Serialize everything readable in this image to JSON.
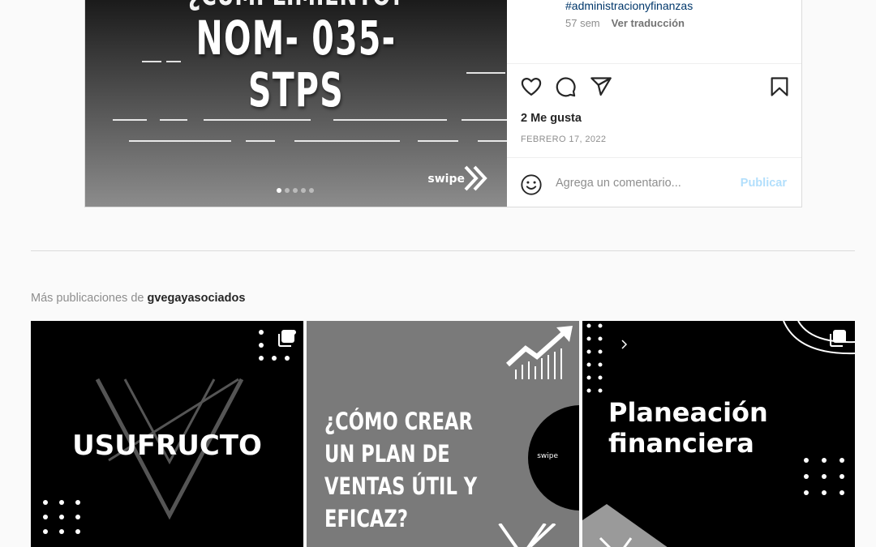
{
  "post": {
    "media": {
      "top_text": "¿CUMPLIMIENTO?",
      "title": "NOM- 035- STPS",
      "swipe_label": "swipe",
      "slide_count": 5,
      "active_slide": 1
    },
    "hashtag": "#administracionyfinanzas",
    "age": "57 sem",
    "see_translation": "Ver traducción",
    "likes": "2 Me gusta",
    "date": "FEBRERO 17, 2022",
    "comment_placeholder": "Agrega un comentario...",
    "publish_label": "Publicar"
  },
  "more_posts": {
    "heading_prefix": "Más publicaciones de",
    "username": "gvegayasociados",
    "tiles": [
      {
        "text": "USUFRUCTO"
      },
      {
        "text": "¿CÓMO CREAR UN PLAN DE VENTAS ÚTIL Y EFICAZ?",
        "badge": "swipe"
      },
      {
        "text": "Planeación financiera"
      }
    ]
  },
  "colors": {
    "link": "#00376b",
    "muted": "#8e8e8e",
    "publish_disabled": "#b2dffc",
    "divider": "#dbdbdb"
  },
  "icons": [
    "heart-icon",
    "comment-icon",
    "share-icon",
    "bookmark-icon",
    "emoji-icon",
    "multiple-posts-icon",
    "swipe-arrows-icon"
  ]
}
